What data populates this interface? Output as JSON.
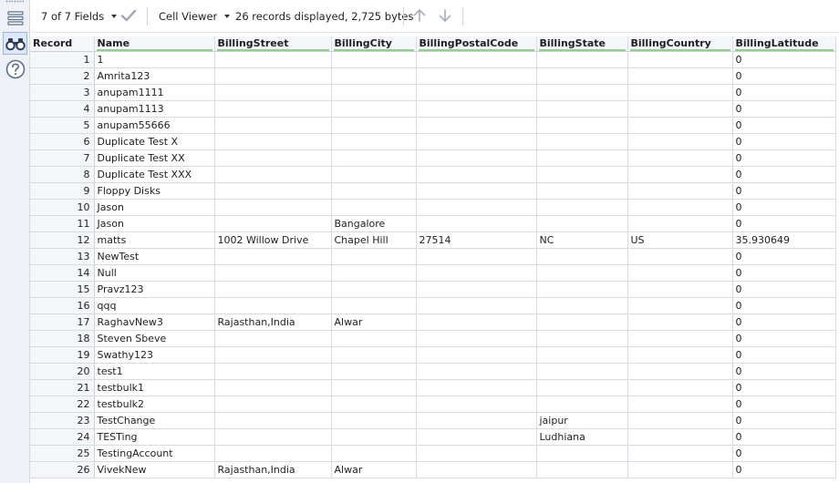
{
  "toolbar": {
    "fields_label": "7 of 7 Fields",
    "viewer_label": "Cell Viewer",
    "status": "26 records displayed, 2,725 bytes"
  },
  "icons": {
    "rail": [
      "list-view-icon",
      "binoculars-icon",
      "help-icon"
    ],
    "toolbar": [
      "chevron-down-icon",
      "checkmark-icon",
      "arrow-up-icon",
      "arrow-down-icon"
    ]
  },
  "colors": {
    "field_bar": "#8fd08f",
    "active_tool": "#dde7f5"
  },
  "columns": [
    "Record",
    "Name",
    "BillingStreet",
    "BillingCity",
    "BillingPostalCode",
    "BillingState",
    "BillingCountry",
    "BillingLatitude"
  ],
  "rows": [
    [
      "1",
      "1",
      "",
      "",
      "",
      "",
      "",
      "0"
    ],
    [
      "2",
      "Amrita123",
      "",
      "",
      "",
      "",
      "",
      "0"
    ],
    [
      "3",
      "anupam1111",
      "",
      "",
      "",
      "",
      "",
      "0"
    ],
    [
      "4",
      "anupam1113",
      "",
      "",
      "",
      "",
      "",
      "0"
    ],
    [
      "5",
      "anupam55666",
      "",
      "",
      "",
      "",
      "",
      "0"
    ],
    [
      "6",
      "Duplicate Test X",
      "",
      "",
      "",
      "",
      "",
      "0"
    ],
    [
      "7",
      "Duplicate Test XX",
      "",
      "",
      "",
      "",
      "",
      "0"
    ],
    [
      "8",
      "Duplicate Test XXX",
      "",
      "",
      "",
      "",
      "",
      "0"
    ],
    [
      "9",
      "Floppy Disks",
      "",
      "",
      "",
      "",
      "",
      "0"
    ],
    [
      "10",
      "Jason",
      "",
      "",
      "",
      "",
      "",
      "0"
    ],
    [
      "11",
      "Jason",
      "",
      "Bangalore",
      "",
      "",
      "",
      "0"
    ],
    [
      "12",
      "matts",
      "1002 Willow Drive",
      "Chapel Hill",
      "27514",
      "NC",
      "US",
      "35.930649"
    ],
    [
      "13",
      "NewTest",
      "",
      "",
      "",
      "",
      "",
      "0"
    ],
    [
      "14",
      "Null",
      "",
      "",
      "",
      "",
      "",
      "0"
    ],
    [
      "15",
      "Pravz123",
      "",
      "",
      "",
      "",
      "",
      "0"
    ],
    [
      "16",
      "qqq",
      "",
      "",
      "",
      "",
      "",
      "0"
    ],
    [
      "17",
      "RaghavNew3",
      "Rajasthan,India",
      "Alwar",
      "",
      "",
      "",
      "0"
    ],
    [
      "18",
      "Steven Sbeve",
      "",
      "",
      "",
      "",
      "",
      "0"
    ],
    [
      "19",
      "Swathy123",
      "",
      "",
      "",
      "",
      "",
      "0"
    ],
    [
      "20",
      "test1",
      "",
      "",
      "",
      "",
      "",
      "0"
    ],
    [
      "21",
      "testbulk1",
      "",
      "",
      "",
      "",
      "",
      "0"
    ],
    [
      "22",
      "testbulk2",
      "",
      "",
      "",
      "",
      "",
      "0"
    ],
    [
      "23",
      "TestChange",
      "",
      "",
      "",
      "jaipur",
      "",
      "0"
    ],
    [
      "24",
      "TESTing",
      "",
      "",
      "",
      "Ludhiana",
      "",
      "0"
    ],
    [
      "25",
      "TestingAccount",
      "",
      "",
      "",
      "",
      "",
      "0"
    ],
    [
      "26",
      "VivekNew",
      "Rajasthan,India",
      "Alwar",
      "",
      "",
      "",
      "0"
    ]
  ]
}
